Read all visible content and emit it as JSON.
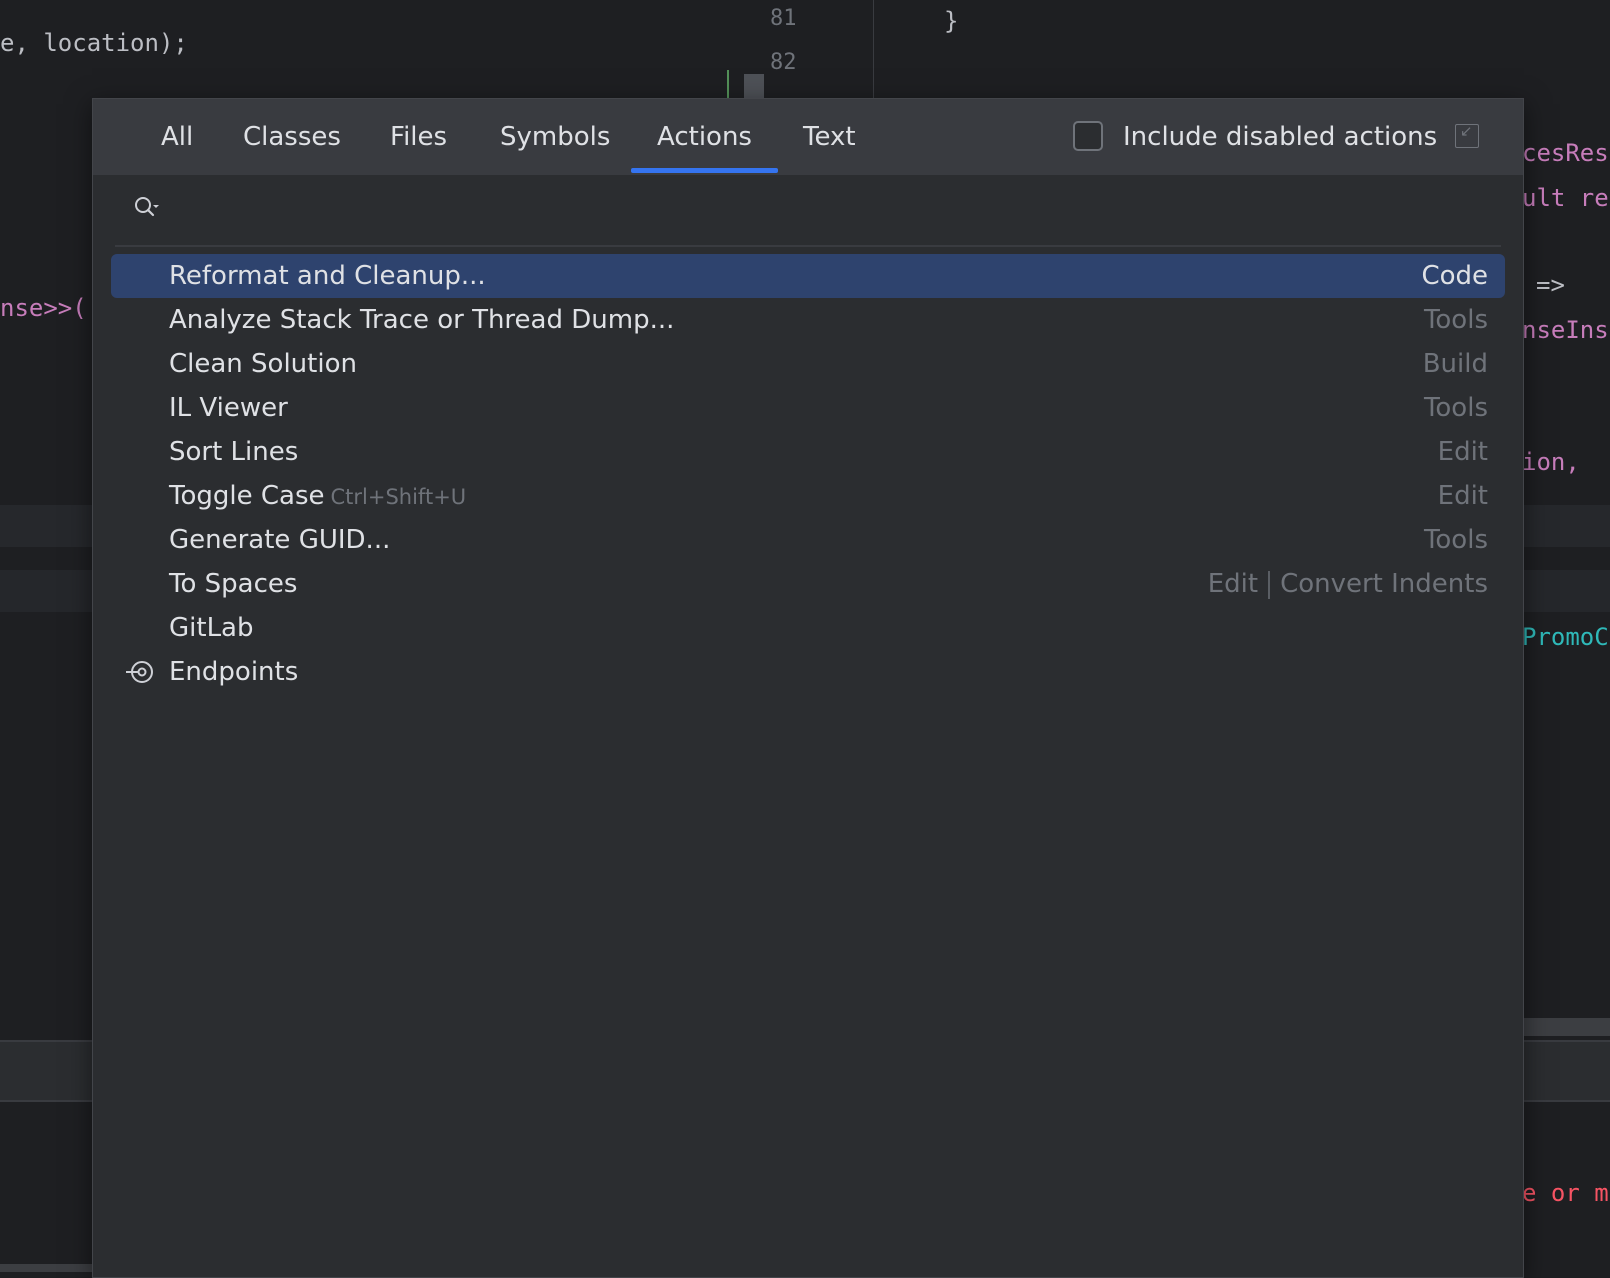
{
  "editor": {
    "line_numbers": [
      "81",
      "82"
    ],
    "code_fragments": {
      "top_left": "e, location);",
      "left_mid": "nse>>(",
      "brace": "}",
      "right_1": "cesRes",
      "right_2": "ult re",
      "right_3": "=>",
      "right_4": "nseIns",
      "right_5": "ion,",
      "right_6": "PromoC",
      "right_7": "e or m"
    }
  },
  "popup": {
    "tabs": [
      {
        "label": "All"
      },
      {
        "label": "Classes"
      },
      {
        "label": "Files"
      },
      {
        "label": "Symbols"
      },
      {
        "label": "Actions",
        "active": true
      },
      {
        "label": "Text"
      }
    ],
    "include_disabled_label": "Include disabled actions",
    "include_disabled_checked": false,
    "search": {
      "value": "",
      "placeholder": ""
    },
    "results": [
      {
        "label": "Reformat and Cleanup...",
        "shortcut": "",
        "group": "Code",
        "selected": true
      },
      {
        "label": "Analyze Stack Trace or Thread Dump...",
        "shortcut": "",
        "group": "Tools"
      },
      {
        "label": "Clean Solution",
        "shortcut": "",
        "group": "Build"
      },
      {
        "label": "IL Viewer",
        "shortcut": "",
        "group": "Tools"
      },
      {
        "label": "Sort Lines",
        "shortcut": "",
        "group": "Edit"
      },
      {
        "label": "Toggle Case",
        "shortcut": "Ctrl+Shift+U",
        "group": "Edit"
      },
      {
        "label": "Generate GUID...",
        "shortcut": "",
        "group": "Tools"
      },
      {
        "label": "To Spaces",
        "shortcut": "",
        "group": "Edit",
        "group2": "Convert Indents"
      },
      {
        "label": "GitLab",
        "shortcut": "",
        "group": ""
      },
      {
        "label": "Endpoints",
        "shortcut": "",
        "group": "",
        "icon": "endpoints-icon"
      }
    ]
  },
  "colors": {
    "accent": "#3574f0",
    "selection": "#2e436e",
    "popup_bg": "#2b2d30"
  }
}
